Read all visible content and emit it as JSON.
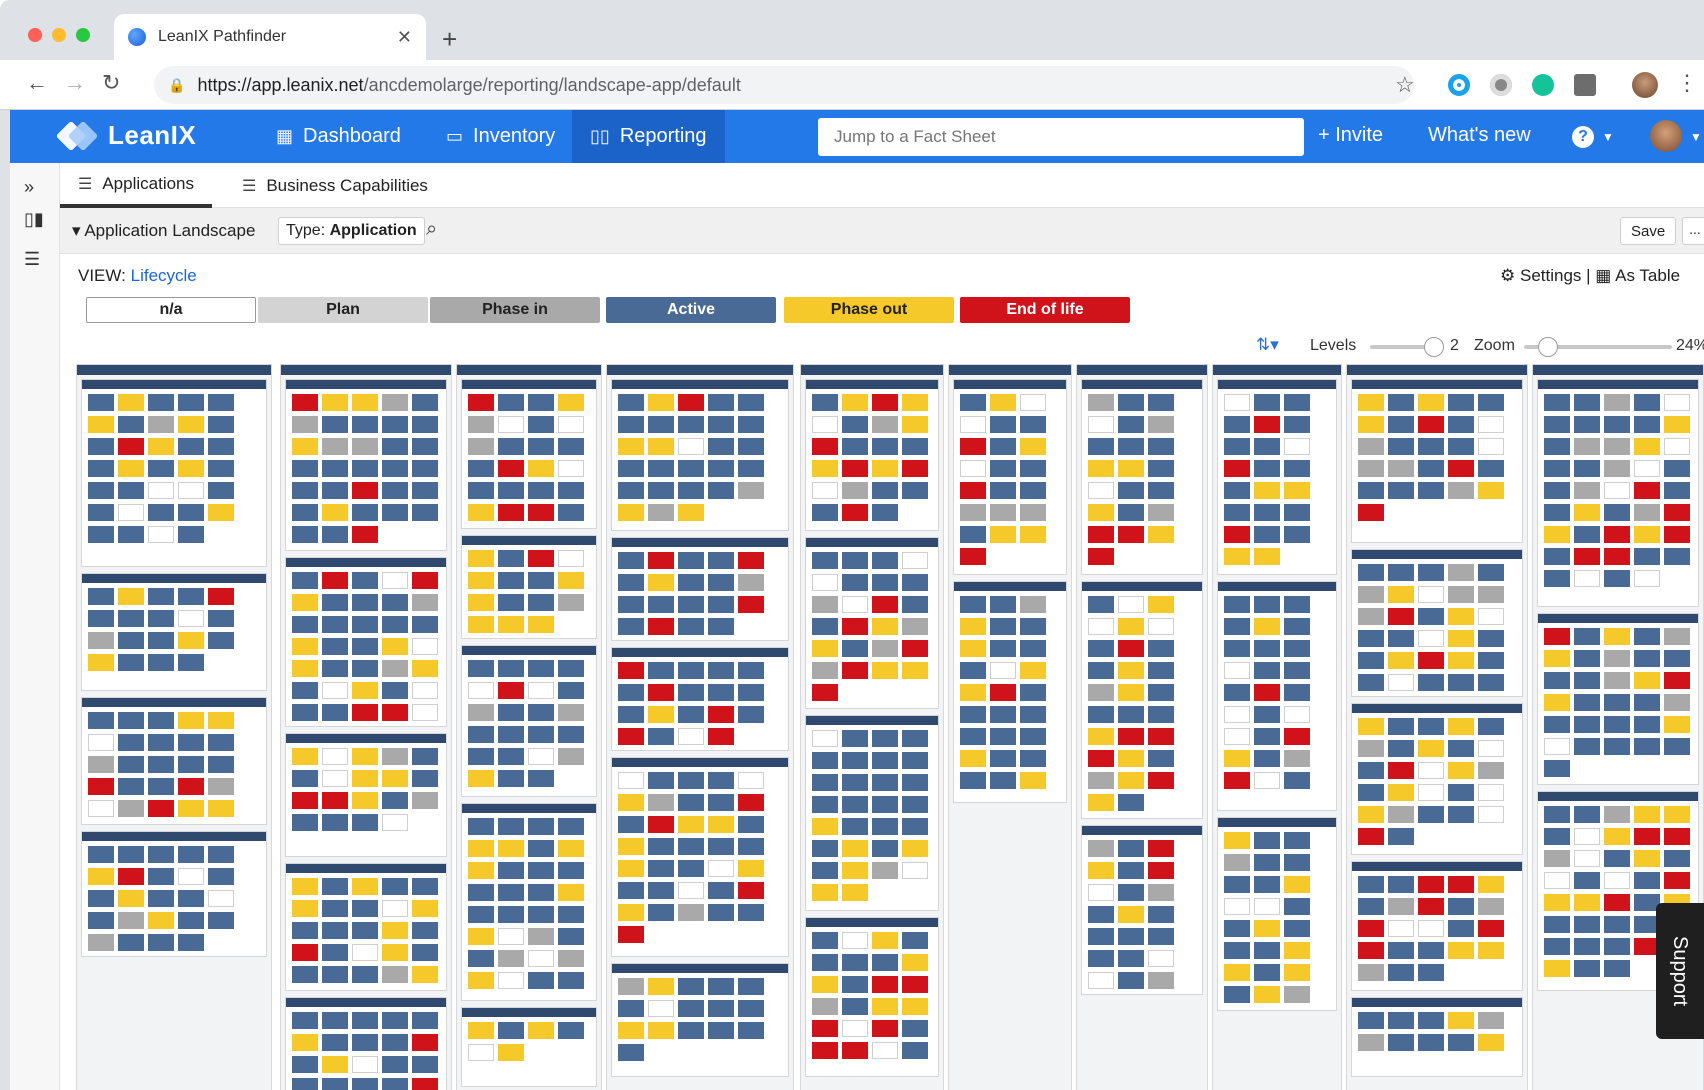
{
  "browser": {
    "tab_title": "LeanIX Pathfinder",
    "url_host": "https://app.leanix.net",
    "url_path": "/ancdemolarge/reporting/landscape-app/default"
  },
  "header": {
    "logo": "LeanIX",
    "nav": [
      {
        "label": "Dashboard",
        "icon": "grid-icon"
      },
      {
        "label": "Inventory",
        "icon": "inventory-icon"
      },
      {
        "label": "Reporting",
        "icon": "bar-chart-icon"
      }
    ],
    "search_placeholder": "Jump to a Fact Sheet",
    "invite_label": "+ Invite",
    "whats_new_label": "What's new",
    "help_label": "?"
  },
  "subtabs": [
    {
      "label": "Applications",
      "icon": "filter-icon"
    },
    {
      "label": "Business Capabilities",
      "icon": "filter-icon"
    }
  ],
  "report": {
    "title": "Application Landscape",
    "type_prefix": "Type:",
    "type_value": "Application",
    "save_label": "Save",
    "more_label": "..."
  },
  "view": {
    "prefix": "VIEW:",
    "value": "Lifecycle",
    "settings_label": "Settings",
    "as_table_label": "As Table"
  },
  "legend": [
    {
      "label": "n/a",
      "bg": "#ffffff",
      "fg": "#222222",
      "border": "#9a9a9a"
    },
    {
      "label": "Plan",
      "bg": "#d3d3d3",
      "fg": "#222222",
      "border": "#d3d3d3"
    },
    {
      "label": "Phase in",
      "bg": "#a9a9a9",
      "fg": "#222222",
      "border": "#a9a9a9"
    },
    {
      "label": "Active",
      "bg": "#4a6a96",
      "fg": "#ffffff",
      "border": "#4a6a96"
    },
    {
      "label": "Phase out",
      "bg": "#f6c92b",
      "fg": "#222222",
      "border": "#f6c92b"
    },
    {
      "label": "End of life",
      "bg": "#d0131b",
      "fg": "#ffffff",
      "border": "#d0131b"
    }
  ],
  "controls": {
    "levels_label": "Levels",
    "levels_value": "2",
    "zoom_label": "Zoom",
    "zoom_value": "24%"
  },
  "support_label": "Support"
}
